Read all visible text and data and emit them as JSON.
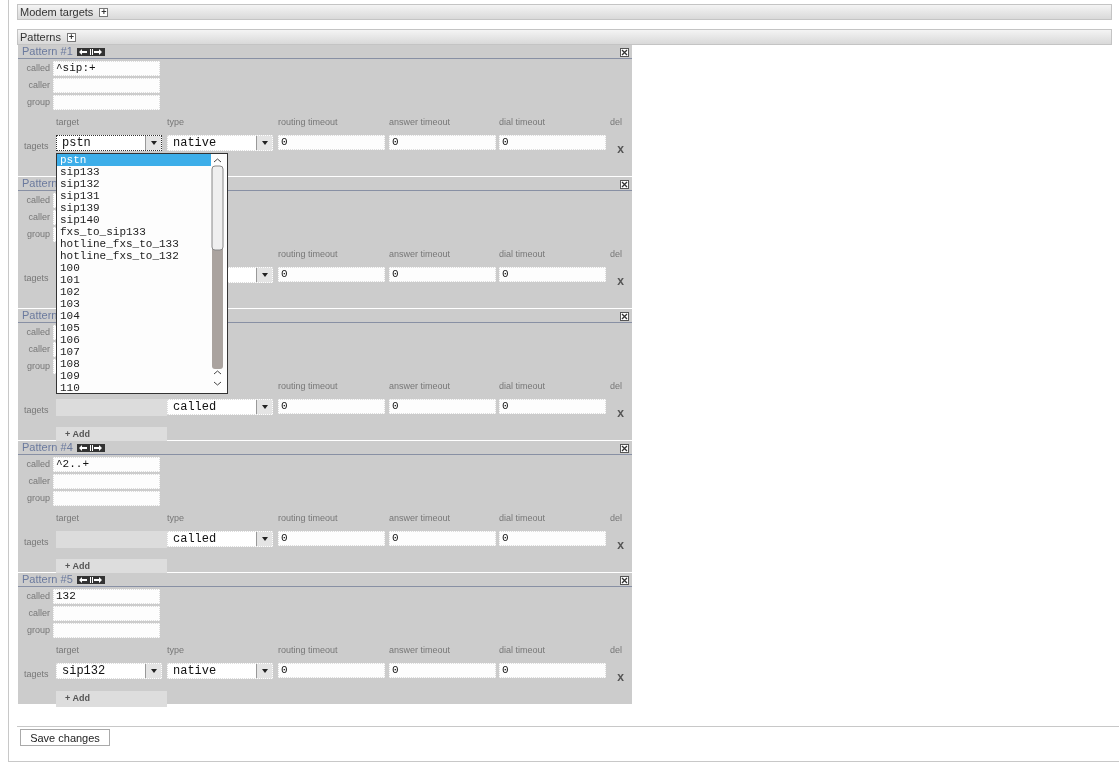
{
  "sections": [
    {
      "title": "Modem targets",
      "toggle": "+"
    },
    {
      "title": "Patterns",
      "toggle": "+"
    }
  ],
  "patterns": [
    {
      "title": "Pattern #1",
      "reorder_buttons": true,
      "fields": [
        {
          "label": "called",
          "value": "^sip:+"
        },
        {
          "label": "caller"
        },
        {
          "label": "group"
        }
      ],
      "columns": [
        {
          "kind": "target",
          "label": "target"
        },
        {
          "kind": "type",
          "label": "type"
        },
        {
          "kind": "routing",
          "label": "routing timeout"
        },
        {
          "kind": "answer",
          "label": "answer timeout"
        },
        {
          "kind": "dial",
          "label": "dial timeout"
        },
        {
          "kind": "del",
          "label": "del"
        }
      ],
      "row_label": "tagets",
      "target": {
        "kind": "select",
        "value": "pstn",
        "focused": true
      },
      "type": {
        "kind": "select",
        "value": "native"
      },
      "routing": "0",
      "answer": "0",
      "dial": "0",
      "delete": "x"
    },
    {
      "title": "Pattern",
      "reorder_buttons": false,
      "fields": [
        {
          "label": "called"
        },
        {
          "label": "caller"
        },
        {
          "label": "group"
        }
      ],
      "columns": [
        {
          "kind": "routing",
          "label": "routing timeout"
        },
        {
          "kind": "answer",
          "label": "answer timeout"
        },
        {
          "kind": "dial",
          "label": "dial timeout"
        },
        {
          "kind": "del",
          "label": "del"
        }
      ],
      "row_label": "tagets",
      "type": {
        "kind": "select"
      },
      "routing": "0",
      "answer": "0",
      "dial": "0",
      "delete": "x"
    },
    {
      "title": "Pattern",
      "reorder_buttons": false,
      "fields": [
        {
          "label": "called"
        },
        {
          "label": "caller"
        },
        {
          "label": "group"
        }
      ],
      "columns": [
        {
          "kind": "routing",
          "label": "routing timeout"
        },
        {
          "kind": "answer",
          "label": "answer timeout"
        },
        {
          "kind": "dial",
          "label": "dial timeout"
        },
        {
          "kind": "del",
          "label": "del"
        }
      ],
      "row_label": "tagets",
      "target": {
        "kind": "empty"
      },
      "type": {
        "kind": "select",
        "value": "called"
      },
      "routing": "0",
      "answer": "0",
      "dial": "0",
      "delete": "x",
      "add_button": "+ Add"
    },
    {
      "title": "Pattern #4",
      "reorder_buttons": true,
      "fields": [
        {
          "label": "called",
          "value": "^2..+"
        },
        {
          "label": "caller"
        },
        {
          "label": "group"
        }
      ],
      "columns": [
        {
          "kind": "target",
          "label": "target"
        },
        {
          "kind": "type",
          "label": "type"
        },
        {
          "kind": "routing",
          "label": "routing timeout"
        },
        {
          "kind": "answer",
          "label": "answer timeout"
        },
        {
          "kind": "dial",
          "label": "dial timeout"
        },
        {
          "kind": "del",
          "label": "del"
        }
      ],
      "row_label": "tagets",
      "target": {
        "kind": "empty"
      },
      "type": {
        "kind": "select",
        "value": "called"
      },
      "routing": "0",
      "answer": "0",
      "dial": "0",
      "delete": "x",
      "add_button": "+ Add"
    },
    {
      "title": "Pattern #5",
      "reorder_buttons": true,
      "fields": [
        {
          "label": "called",
          "value": "132"
        },
        {
          "label": "caller"
        },
        {
          "label": "group"
        }
      ],
      "columns": [
        {
          "kind": "target",
          "label": "target"
        },
        {
          "kind": "type",
          "label": "type"
        },
        {
          "kind": "routing",
          "label": "routing timeout"
        },
        {
          "kind": "answer",
          "label": "answer timeout"
        },
        {
          "kind": "dial",
          "label": "dial timeout"
        },
        {
          "kind": "del",
          "label": "del"
        }
      ],
      "row_label": "tagets",
      "target": {
        "kind": "select",
        "value": "sip132",
        "focused": false
      },
      "type": {
        "kind": "select",
        "value": "native"
      },
      "routing": "0",
      "answer": "0",
      "dial": "0",
      "delete": "x",
      "add_button": "+ Add"
    }
  ],
  "dropdown": {
    "options": [
      {
        "label": "pstn",
        "selected": true
      },
      {
        "label": "sip133",
        "selected": false
      },
      {
        "label": "sip132",
        "selected": false
      },
      {
        "label": "sip131",
        "selected": false
      },
      {
        "label": "sip139",
        "selected": false
      },
      {
        "label": "sip140",
        "selected": false
      },
      {
        "label": "fxs_to_sip133",
        "selected": false
      },
      {
        "label": "hotline_fxs_to_133",
        "selected": false
      },
      {
        "label": "hotline_fxs_to_132",
        "selected": false
      },
      {
        "label": "100",
        "selected": false
      },
      {
        "label": "101",
        "selected": false
      },
      {
        "label": "102",
        "selected": false
      },
      {
        "label": "103",
        "selected": false
      },
      {
        "label": "104",
        "selected": false
      },
      {
        "label": "105",
        "selected": false
      },
      {
        "label": "106",
        "selected": false
      },
      {
        "label": "107",
        "selected": false
      },
      {
        "label": "108",
        "selected": false
      },
      {
        "label": "109",
        "selected": false
      },
      {
        "label": "110",
        "selected": false
      }
    ]
  },
  "save_button": "Save changes"
}
